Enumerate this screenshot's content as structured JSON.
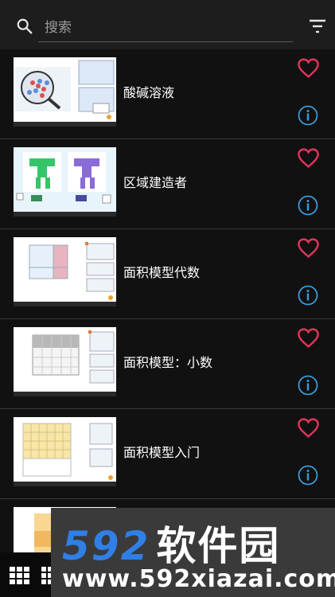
{
  "search": {
    "placeholder": "搜索"
  },
  "icons": {
    "search": "search-icon",
    "filter": "filter-icon",
    "favorite": "heart-outline-icon",
    "info": "info-circle-icon",
    "grid": "grid-icon"
  },
  "colors": {
    "heart": "#e0355a",
    "info": "#3b9ad9",
    "background": "#111111",
    "topbar": "#1d1d1d"
  },
  "items": [
    {
      "title": "酸碱溶液"
    },
    {
      "title": "区域建造者"
    },
    {
      "title": "面积模型代数"
    },
    {
      "title": "面积模型：小数"
    },
    {
      "title": "面积模型入门"
    },
    {
      "title": ""
    }
  ],
  "watermark": {
    "brand_num": "592",
    "brand_cn": "软件园",
    "url": "www.592xiazai.com"
  }
}
